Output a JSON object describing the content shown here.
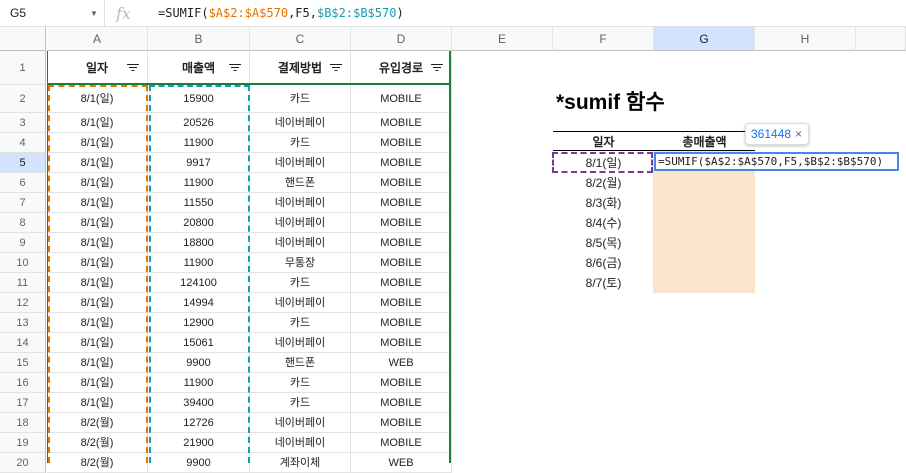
{
  "formula_bar": {
    "cell_ref": "G5",
    "fx_label": "fx",
    "formula_prefix": "=SUMIF(",
    "formula_ref_a": "$A$2:$A$570",
    "formula_mid": ",F5,",
    "formula_ref_b": "$B$2:$B$570",
    "formula_suffix": ")"
  },
  "columns": [
    "A",
    "B",
    "C",
    "D",
    "E",
    "F",
    "G",
    "H"
  ],
  "table_header": {
    "row_num": "1",
    "cells": [
      "일자",
      "매출액",
      "결제방법",
      "유입경로"
    ]
  },
  "rows": [
    {
      "n": "2",
      "date": "8/1(일)",
      "amount": "15900",
      "method": "카드",
      "channel": "MOBILE"
    },
    {
      "n": "3",
      "date": "8/1(일)",
      "amount": "20526",
      "method": "네이버페이",
      "channel": "MOBILE"
    },
    {
      "n": "4",
      "date": "8/1(일)",
      "amount": "11900",
      "method": "카드",
      "channel": "MOBILE"
    },
    {
      "n": "5",
      "date": "8/1(일)",
      "amount": "9917",
      "method": "네이버페이",
      "channel": "MOBILE"
    },
    {
      "n": "6",
      "date": "8/1(일)",
      "amount": "11900",
      "method": "핸드폰",
      "channel": "MOBILE"
    },
    {
      "n": "7",
      "date": "8/1(일)",
      "amount": "11550",
      "method": "네이버페이",
      "channel": "MOBILE"
    },
    {
      "n": "8",
      "date": "8/1(일)",
      "amount": "20800",
      "method": "네이버페이",
      "channel": "MOBILE"
    },
    {
      "n": "9",
      "date": "8/1(일)",
      "amount": "18800",
      "method": "네이버페이",
      "channel": "MOBILE"
    },
    {
      "n": "10",
      "date": "8/1(일)",
      "amount": "11900",
      "method": "무통장",
      "channel": "MOBILE"
    },
    {
      "n": "11",
      "date": "8/1(일)",
      "amount": "124100",
      "method": "카드",
      "channel": "MOBILE"
    },
    {
      "n": "12",
      "date": "8/1(일)",
      "amount": "14994",
      "method": "네이버페이",
      "channel": "MOBILE"
    },
    {
      "n": "13",
      "date": "8/1(일)",
      "amount": "12900",
      "method": "카드",
      "channel": "MOBILE"
    },
    {
      "n": "14",
      "date": "8/1(일)",
      "amount": "15061",
      "method": "네이버페이",
      "channel": "MOBILE"
    },
    {
      "n": "15",
      "date": "8/1(일)",
      "amount": "9900",
      "method": "핸드폰",
      "channel": "WEB"
    },
    {
      "n": "16",
      "date": "8/1(일)",
      "amount": "11900",
      "method": "카드",
      "channel": "MOBILE"
    },
    {
      "n": "17",
      "date": "8/1(일)",
      "amount": "39400",
      "method": "카드",
      "channel": "MOBILE"
    },
    {
      "n": "18",
      "date": "8/2(월)",
      "amount": "12726",
      "method": "네이버페이",
      "channel": "MOBILE"
    },
    {
      "n": "19",
      "date": "8/2(월)",
      "amount": "21900",
      "method": "네이버페이",
      "channel": "MOBILE"
    },
    {
      "n": "20",
      "date": "8/2(월)",
      "amount": "9900",
      "method": "계좌이체",
      "channel": "WEB"
    }
  ],
  "summary": {
    "title": "*sumif 함수",
    "head_date": "일자",
    "head_total": "총매출액",
    "dates": [
      "8/1(일)",
      "8/2(월)",
      "8/3(화)",
      "8/4(수)",
      "8/5(목)",
      "8/6(금)",
      "8/7(토)"
    ],
    "edit_formula_prefix": "=SUMIF(",
    "edit_formula_args": "$A$2:$A$570,F5,$B$2:$B$570",
    "edit_formula_suffix": ")",
    "tooltip_value": "361448",
    "tooltip_close": "×"
  },
  "colors": {
    "range_a": "#e37400",
    "range_b": "#129eaf",
    "criteria": "#7e3794",
    "active_edit": "#4a86e8",
    "result_fill": "#fce5cd",
    "table_border": "#188038"
  }
}
